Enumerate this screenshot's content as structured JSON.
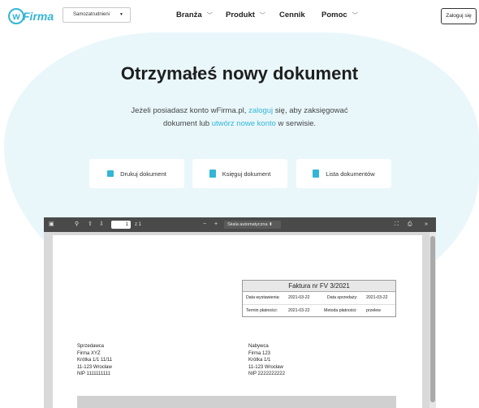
{
  "header": {
    "logo_letter": "w",
    "logo_text": "Firma",
    "select_value": "Samozatrudnieni",
    "nav": [
      {
        "label": "Branża",
        "has_dropdown": true
      },
      {
        "label": "Produkt",
        "has_dropdown": true
      },
      {
        "label": "Cennik",
        "has_dropdown": false
      },
      {
        "label": "Pomoc",
        "has_dropdown": true
      }
    ],
    "login_label": "Zaloguj się"
  },
  "hero": {
    "title": "Otrzymałeś nowy dokument",
    "sub_1": "Jeżeli posiadasz konto wFirma.pl, ",
    "sub_link_1": "zaloguj",
    "sub_2": " się, aby zaksięgować dokument lub ",
    "sub_link_2": "utwórz nowe konto",
    "sub_3": " w serwisie."
  },
  "actions": [
    {
      "label": "Drukuj dokument",
      "icon": "printer-icon"
    },
    {
      "label": "Księguj dokument",
      "icon": "document-plus-icon"
    },
    {
      "label": "Lista dokumentów",
      "icon": "document-icon"
    }
  ],
  "viewer": {
    "page_number": "1",
    "page_total": "z 1",
    "zoom_label": "Skala automatyczna",
    "invoice": {
      "title": "Faktura nr FV 3/2021",
      "issue_label": "Data wystawienia:",
      "issue_value": "2021-03-22",
      "sale_label": "Data sprzedaży:",
      "sale_value": "2021-03-22",
      "due_label": "Termin płatności:",
      "due_value": "2021-03-22",
      "method_label": "Metoda płatności:",
      "method_value": "przelew"
    },
    "seller": {
      "heading": "Sprzedawca",
      "name": "Firma XYZ",
      "street": "Krótka 1/1 11/11",
      "city": "11-123 Wrocław",
      "nip": "NIP 1111111111"
    },
    "buyer": {
      "heading": "Nabywca",
      "name": "Firma 123",
      "street": "Krótka 1/1",
      "city": "11-123 Wrocław",
      "nip": "NIP 2222222222"
    }
  },
  "colors": {
    "accent": "#33b5d6",
    "hero_bg": "#e9f7fb",
    "toolbar": "#4a4a4a"
  }
}
